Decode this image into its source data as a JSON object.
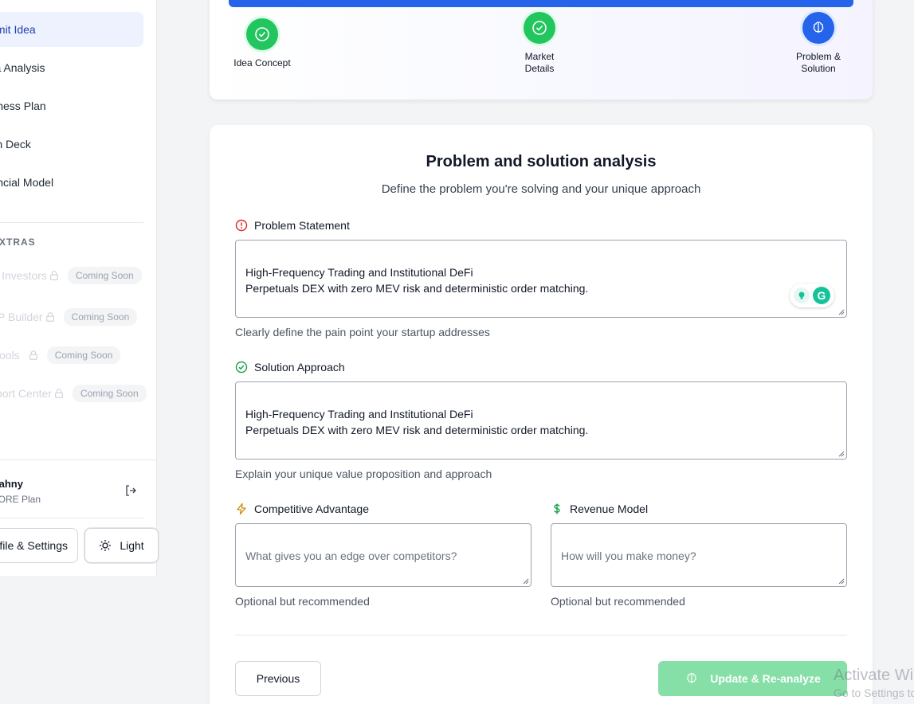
{
  "sidebar": {
    "nav": [
      {
        "label": "Submit Idea"
      },
      {
        "label": "Idea Analysis"
      },
      {
        "label": "Business Plan"
      },
      {
        "label": "Pitch Deck"
      },
      {
        "label": "Financial Model"
      }
    ],
    "extras_heading": "EXTRAS",
    "extras": [
      {
        "label": "Find Investors",
        "badge": "Coming Soon"
      },
      {
        "label": "MVP Builder",
        "badge": "Coming Soon"
      },
      {
        "label": "Tools",
        "badge": "Coming Soon"
      },
      {
        "label": "Support Center",
        "badge": "Coming Soon"
      }
    ],
    "user": {
      "name": "Shahny",
      "plan": "CORE Plan"
    },
    "profile_button": "Profile & Settings",
    "theme_button": "Light"
  },
  "progress": {
    "steps": [
      {
        "label": "Idea Concept",
        "state": "complete"
      },
      {
        "label": "Market Details",
        "state": "complete"
      },
      {
        "label": "Problem & Solution",
        "state": "current"
      }
    ]
  },
  "form": {
    "title": "Problem and solution analysis",
    "subtitle": "Define the problem you're solving and your unique approach",
    "problem": {
      "label": "Problem Statement",
      "value": "High-Frequency Trading and Institutional DeFi\nPerpetuals DEX with zero MEV risk and deterministic order matching.",
      "help": "Clearly define the pain point your startup addresses"
    },
    "solution": {
      "label": "Solution Approach",
      "value": "High-Frequency Trading and Institutional DeFi\nPerpetuals DEX with zero MEV risk and deterministic order matching.",
      "help": "Explain your unique value proposition and approach"
    },
    "advantage": {
      "label": "Competitive Advantage",
      "placeholder": "What gives you an edge over competitors?",
      "help": "Optional but recommended"
    },
    "revenue": {
      "label": "Revenue Model",
      "placeholder": "How will you make money?",
      "help": "Optional but recommended"
    },
    "previous_button": "Previous",
    "update_button": "Update & Re-analyze"
  },
  "grammarly_letter": "G",
  "watermark": {
    "line1": "Activate Windows",
    "line2": "Go to Settings to activate Windows."
  },
  "colors": {
    "accent": "#2563eb",
    "success": "#22c55e",
    "error": "#dc2626",
    "warning": "#ca8a04"
  }
}
